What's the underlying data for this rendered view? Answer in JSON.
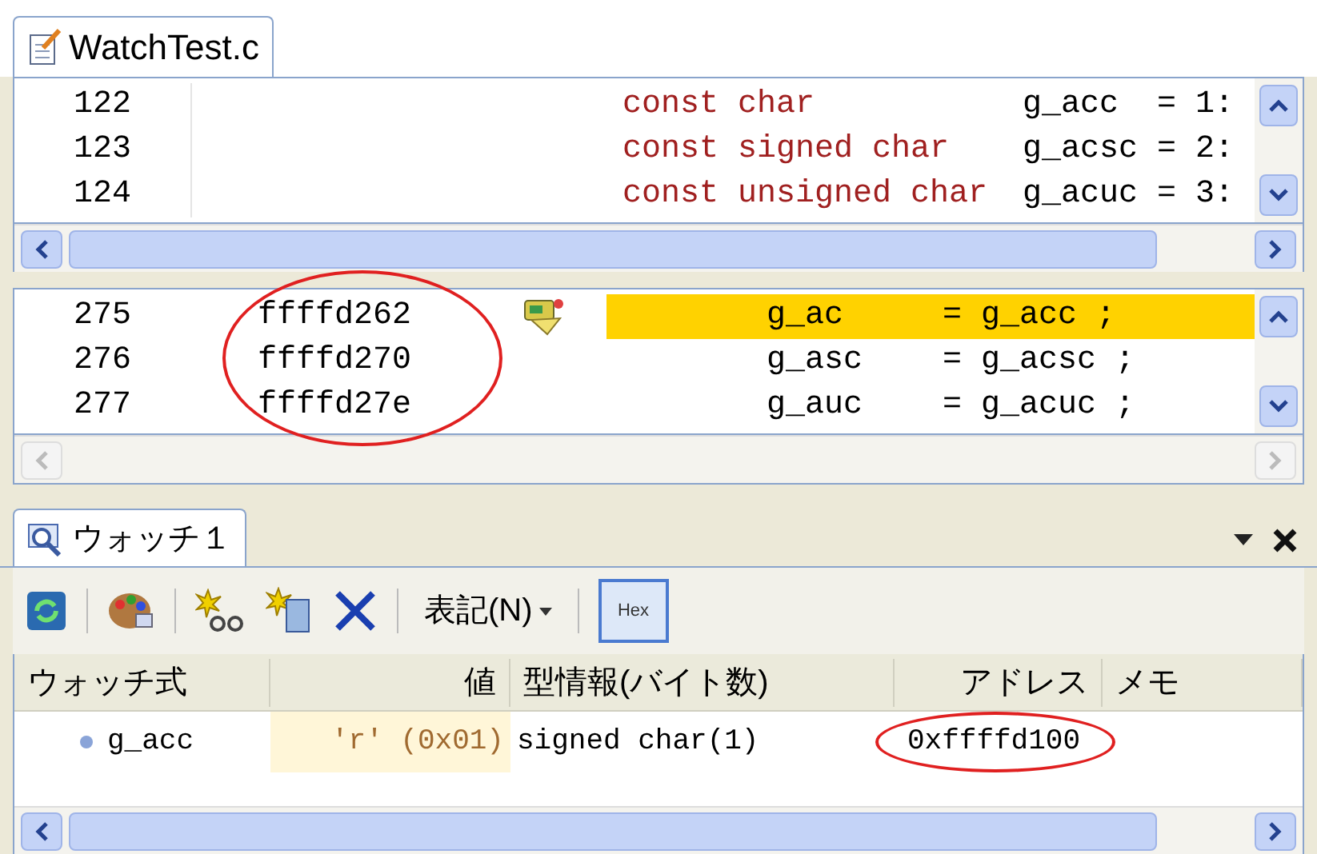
{
  "editor": {
    "tab": {
      "title": "WatchTest.c",
      "selected": true
    },
    "upper_pane": {
      "rows": [
        {
          "line": "122",
          "type": "const char",
          "decl": "g_acc  = 1:"
        },
        {
          "line": "123",
          "type": "const signed char",
          "decl": "g_acsc = 2:"
        },
        {
          "line": "124",
          "type": "const unsigned char",
          "decl": "g_acuc = 3:"
        }
      ]
    },
    "lower_pane": {
      "rows": [
        {
          "line": "275",
          "address": "ffffd262",
          "current": true,
          "lhs": "g_ac",
          "rhs": "= g_acc ;"
        },
        {
          "line": "276",
          "address": "ffffd270",
          "current": false,
          "lhs": "g_asc",
          "rhs": "= g_acsc ;"
        },
        {
          "line": "277",
          "address": "ffffd27e",
          "current": false,
          "lhs": "g_auc",
          "rhs": "= g_acuc ;"
        }
      ]
    }
  },
  "watch": {
    "tab": {
      "title": "ウォッチ１",
      "selected": true
    },
    "toolbar": {
      "notation_menu": "表記(N)",
      "hex_toggle": {
        "label": "Hex",
        "on": true
      }
    },
    "columns": [
      "ウォッチ式",
      "値",
      "型情報(バイト数)",
      "アドレス",
      "メモ"
    ],
    "rows": [
      {
        "expression": "g_acc",
        "value": "'r' (0x01)",
        "changed": true,
        "type": "signed char(1)",
        "address": "0xffffd100"
      }
    ]
  }
}
